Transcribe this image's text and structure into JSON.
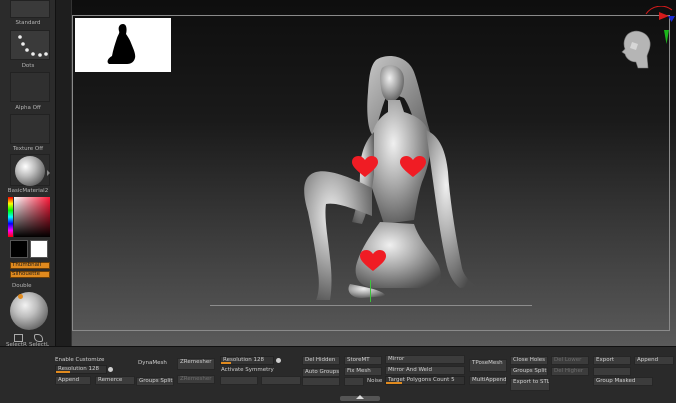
{
  "left_tray": {
    "standard_label": "Standard",
    "dots_label": "Dots",
    "alpha_label": "Alpha Off",
    "texture_label": "Texture Off",
    "material_label": "BasicMaterial2",
    "thumbnail_label": "Thumbnail",
    "silhouette_label": "Silhouette",
    "double_label": "Double",
    "selectr_label": "SelectR",
    "selecto_label": "SelectL"
  },
  "bottom_tray": {
    "enable_customize": "Enable Customize",
    "resolution_left": "Resolution 128",
    "append": "Append",
    "remerce": "Remerce",
    "dynamesh": "DynaMesh",
    "groups_split": "Groups Split",
    "zremesher": "ZRemesher",
    "zremesher_dim": "ZRemesher",
    "resolution_mid": "Resolution 128",
    "activate_symmetry": "Activate Symmetry",
    "del_hidden": "Del Hidden",
    "auto_groups": "Auto Groups",
    "storemt": "StoreMT",
    "fix_mesh": "Fix Mesh",
    "noise": "Noise",
    "mirror": "Mirror",
    "mirror_and_weld": "Mirror And Weld",
    "target_polygons": "Target Polygons Count 5",
    "tposemesh": "TPoseMesh",
    "multiappend": "MultiAppend",
    "close_holes": "Close Holes",
    "del_lower": "Del Lower",
    "groups_split_2": "Groups Split",
    "del_higher": "Del Higher",
    "export_stl": "Export to STL",
    "export": "Export",
    "append_right": "Append",
    "group_masked": "Group Masked"
  },
  "colors": {
    "accent": "#e08a1e",
    "heart": "#f01c24",
    "frame": "#8a8a8a"
  }
}
